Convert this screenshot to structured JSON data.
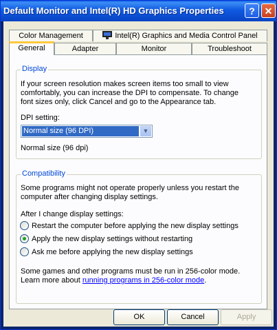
{
  "window": {
    "title": "Default Monitor and Intel(R) HD Graphics Properties",
    "help_glyph": "?",
    "close_glyph": "✕"
  },
  "tabs_back": [
    {
      "label": "Color Management"
    },
    {
      "label": "Intel(R) Graphics and Media Control Panel"
    }
  ],
  "tabs_front": [
    {
      "label": "General",
      "active": true
    },
    {
      "label": "Adapter"
    },
    {
      "label": "Monitor"
    },
    {
      "label": "Troubleshoot"
    }
  ],
  "display": {
    "legend": "Display",
    "description": "If your screen resolution makes screen items too small to view comfortably, you can increase the DPI to compensate.  To change font sizes only, click Cancel and go to the Appearance tab.",
    "dpi_label": "DPI setting:",
    "dpi_selected": "Normal size (96 DPI)",
    "dpi_note": "Normal size (96 dpi)"
  },
  "compatibility": {
    "legend": "Compatibility",
    "description": "Some programs might not operate properly unless you restart the computer after changing display settings.",
    "after_label": "After I change display settings:",
    "options": [
      {
        "label": "Restart the computer before applying the new display settings",
        "checked": false
      },
      {
        "label": "Apply the new display settings without restarting",
        "checked": true
      },
      {
        "label": "Ask me before applying the new display settings",
        "checked": false
      }
    ],
    "games_note": "Some games and other programs must be run in 256-color mode.",
    "learn_prefix": "Learn more about ",
    "learn_link": "running programs in 256-color mode",
    "learn_suffix": "."
  },
  "buttons": {
    "ok": "OK",
    "cancel": "Cancel",
    "apply": "Apply"
  },
  "colors": {
    "titlebar": "#0a5ce2",
    "selection": "#316ac5",
    "legend": "#0046d5",
    "active_tab_accent": "#ffc83c"
  }
}
